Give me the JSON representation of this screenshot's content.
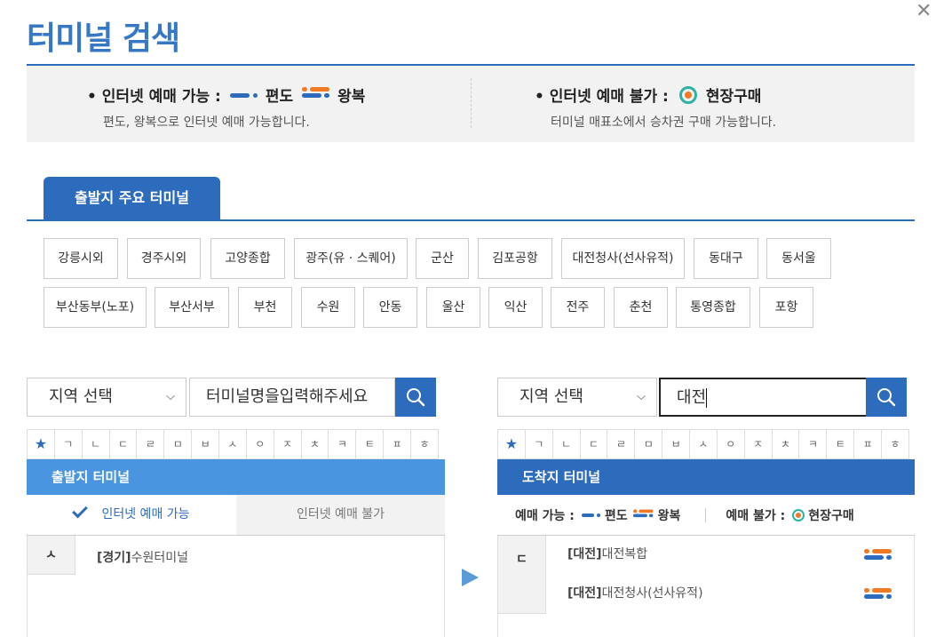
{
  "page_title": "터미널 검색",
  "legend": {
    "online": {
      "label": "• 인터넷 예매 가능 :",
      "oneway_label": "편도",
      "round_label": "왕복",
      "sub": "편도, 왕복으로 인터넷 예매 가능합니다."
    },
    "offline": {
      "label": "• 인터넷 예매 불가 :",
      "onsite_label": "현장구매",
      "sub": "터미널 매표소에서 승차권 구매 가능합니다."
    }
  },
  "major_tab": "출발지 주요 터미널",
  "terminals_row1": [
    "강릉시외",
    "경주시외",
    "고양종합",
    "광주(유 · 스퀘어)",
    "군산",
    "김포공항",
    "대전청사(선사유적)",
    "동대구",
    "동서울"
  ],
  "terminals_row2": [
    "부산동부(노포)",
    "부산서부",
    "부천",
    "수원",
    "안동",
    "울산",
    "익산",
    "전주",
    "춘천",
    "통영종합",
    "포항"
  ],
  "left": {
    "region": "지역 선택",
    "search_placeholder": "터미널명을입력해주세요",
    "consonants": [
      "★",
      "ㄱ",
      "ㄴ",
      "ㄷ",
      "ㄹ",
      "ㅁ",
      "ㅂ",
      "ㅅ",
      "ㅇ",
      "ㅈ",
      "ㅊ",
      "ㅋ",
      "ㅌ",
      "ㅍ",
      "ㅎ"
    ],
    "header": "출발지 터미널",
    "tab_on": "인터넷 예매 가능",
    "tab_off": "인터넷 예매 불가",
    "group_letter": "ㅅ",
    "items": [
      {
        "region": "[경기]",
        "name": "수원터미널"
      }
    ]
  },
  "right": {
    "region": "지역 선택",
    "search_value": "대전",
    "consonants": [
      "★",
      "ㄱ",
      "ㄴ",
      "ㄷ",
      "ㄹ",
      "ㅁ",
      "ㅂ",
      "ㅅ",
      "ㅇ",
      "ㅈ",
      "ㅊ",
      "ㅋ",
      "ㅌ",
      "ㅍ",
      "ㅎ"
    ],
    "header": "도착지 터미널",
    "legend_online": "예매 가능 :",
    "legend_oneway": "편도",
    "legend_round": "왕복",
    "legend_offline": "예매 불가 :",
    "legend_onsite": "현장구매",
    "group_letter": "ㄷ",
    "items": [
      {
        "region": "[대전]",
        "name": "대전복합",
        "icon": "round-trip-icon"
      },
      {
        "region": "[대전]",
        "name": "대전청사(선사유적)",
        "icon": "round-trip-icon"
      }
    ]
  },
  "colors": {
    "brand": "#2d6bbd",
    "title": "#3678c5",
    "left_header": "#4a95e0",
    "right_header": "#2d6bbd",
    "orange": "#f07a24",
    "teal": "#2bb3a6"
  }
}
